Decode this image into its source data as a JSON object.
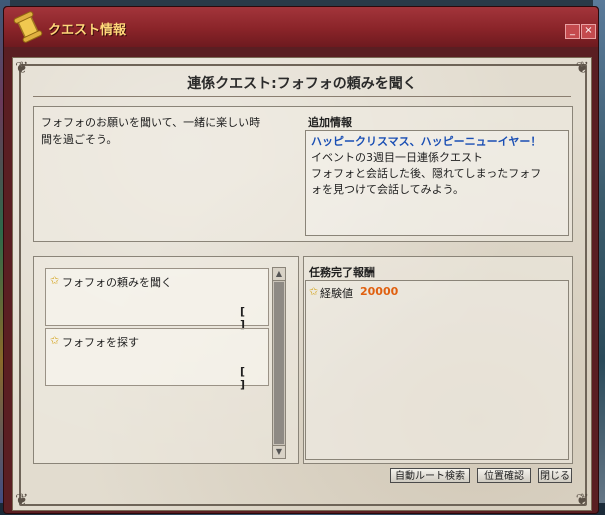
{
  "window": {
    "title": "クエスト情報",
    "minimize": "_",
    "close": "×"
  },
  "quest": {
    "title": "連係クエスト:フォフォの頼みを聞く",
    "description_lines": [
      "フォフォのお願いを聞いて、一緒に楽しい時",
      "間を過ごそう。"
    ]
  },
  "info": {
    "label": "追加情報",
    "lines": [
      "ハッピークリスマス、ハッピーニューイヤー！",
      "イベントの3週目一日連係クエスト",
      "フォフォと会話した後、隠れてしまったフォフ",
      "ォを見つけて会話してみよう。"
    ]
  },
  "objectives": [
    {
      "label": "フォフォの頼みを聞く",
      "count": "[ ]"
    },
    {
      "label": "フォフォを探す",
      "count": "[ ]"
    }
  ],
  "reward": {
    "label": "任務完了報酬",
    "name": "経験値",
    "value": "20000"
  },
  "buttons": {
    "auto_route": "自動ルート検索",
    "position": "位置確認",
    "close": "閉じる"
  },
  "colors": {
    "title_bar": "#8a2429",
    "title_text": "#ffd77a",
    "info_highlight": "#1a4fb4",
    "reward_value": "#e06010"
  }
}
